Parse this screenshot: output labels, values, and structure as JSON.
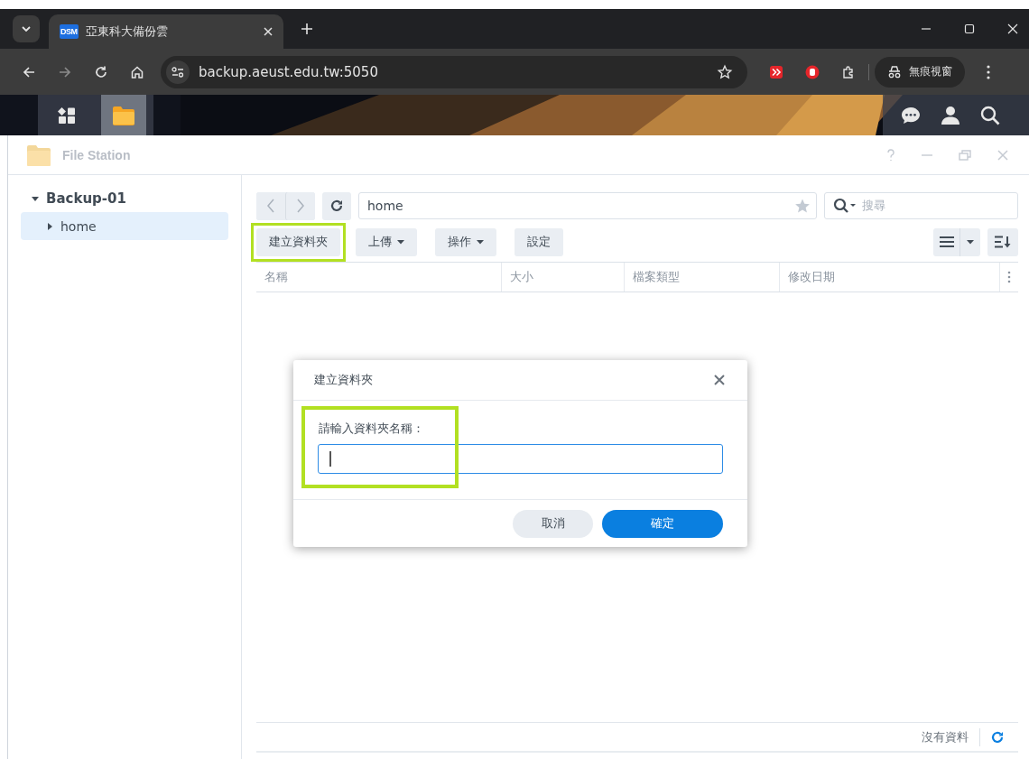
{
  "browser": {
    "tab_title": "亞東科大備份雲",
    "favicon_text": "DSM",
    "url": "backup.aeust.edu.tw:5050",
    "incognito_label": "無痕視窗"
  },
  "window": {
    "title": "File Station"
  },
  "sidebar": {
    "items": [
      {
        "label": "Backup-01",
        "expanded": true,
        "selected": false,
        "children": [
          {
            "label": "home",
            "expanded": false,
            "selected": true
          }
        ]
      }
    ]
  },
  "path": {
    "value": "home"
  },
  "search": {
    "placeholder": "搜尋"
  },
  "toolbar": [
    {
      "label": "建立資料夾",
      "dropdown": false,
      "highlighted": true
    },
    {
      "label": "上傳",
      "dropdown": true,
      "highlighted": false
    },
    {
      "label": "操作",
      "dropdown": true,
      "highlighted": false
    },
    {
      "label": "設定",
      "dropdown": false,
      "highlighted": false
    }
  ],
  "table": {
    "columns": [
      "名稱",
      "大小",
      "檔案類型",
      "修改日期"
    ]
  },
  "status_bar": {
    "text": "沒有資料"
  },
  "dialog": {
    "title": "建立資料夾",
    "label": "請輸入資料夾名稱：",
    "label_highlighted": true,
    "buttons": [
      {
        "label": "取消",
        "kind": "secondary"
      },
      {
        "label": "確定",
        "kind": "primary"
      }
    ]
  }
}
